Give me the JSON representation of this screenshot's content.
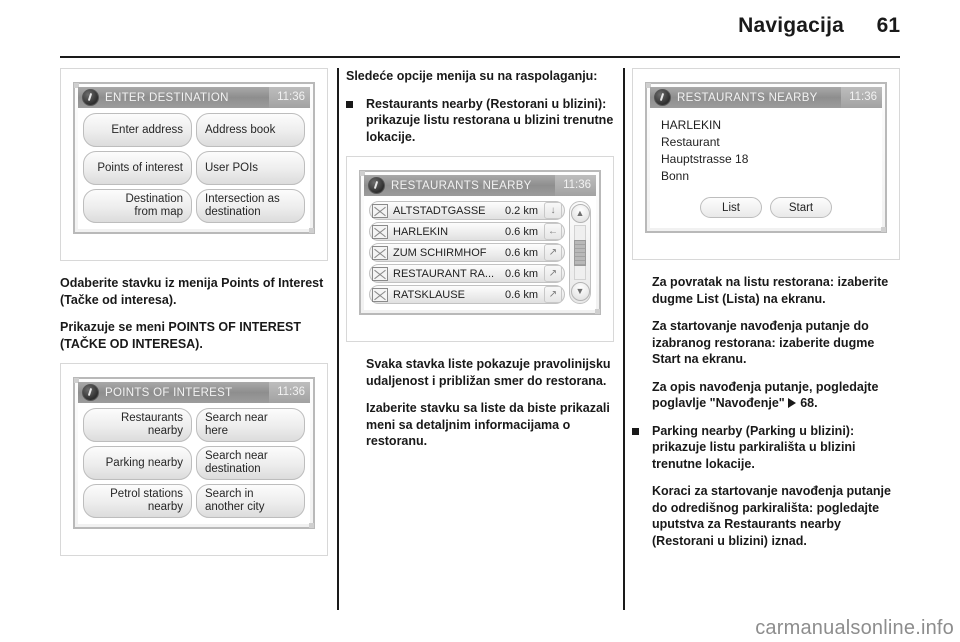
{
  "header": {
    "title": "Navigacija",
    "page_number": "61"
  },
  "watermark": "carmanualsonline.info",
  "columns": {
    "left": {
      "figure1": {
        "title": "ENTER DESTINATION",
        "clock": "11:36",
        "buttons": [
          "Enter address",
          "Address book",
          "Points of interest",
          "User POIs",
          "Destination\nfrom map",
          "Intersection as\ndestination"
        ]
      },
      "para1": "Odaberite stavku iz menija Points of Interest (Tačke od interesa).",
      "para2": "Prikazuje se meni POINTS OF INTEREST (TAČKE OD INTERESA).",
      "figure2": {
        "title": "POINTS OF INTEREST",
        "clock": "11:36",
        "buttons": [
          "Restaurants\nnearby",
          "Search near\nhere",
          "Parking nearby",
          "Search near\ndestination",
          "Petrol stations\nnearby",
          "Search in\nanother city"
        ]
      }
    },
    "middle": {
      "para1": "Sledeće opcije menija su na raspolaganju:",
      "bullet1": "Restaurants nearby (Restorani u blizini): prikazuje listu restorana u blizini trenutne lokacije.",
      "figure1": {
        "title": "RESTAURANTS NEARBY",
        "clock": "11:36",
        "rows": [
          {
            "name": "ALTSTADTGASSE",
            "distance": "0.2 km",
            "arrow": "↓"
          },
          {
            "name": "HARLEKIN",
            "distance": "0.6 km",
            "arrow": "←"
          },
          {
            "name": "ZUM SCHIRMHOF",
            "distance": "0.6 km",
            "arrow": "↗"
          },
          {
            "name": "RESTAURANT RA...",
            "distance": "0.6 km",
            "arrow": "↗"
          },
          {
            "name": "RATSKLAUSE",
            "distance": "0.6 km",
            "arrow": "↗"
          }
        ],
        "scroll_up": "▲",
        "scroll_down": "▼"
      },
      "para2": "Svaka stavka liste pokazuje pravolinijsku udaljenost i približan smer do restorana.",
      "para3": "Izaberite stavku sa liste da biste prikazali meni sa detaljnim informacijama o restoranu."
    },
    "right": {
      "figure1": {
        "title": "RESTAURANTS NEARBY",
        "clock": "11:36",
        "detail_lines": [
          "HARLEKIN",
          "Restaurant",
          "Hauptstrasse 18",
          "Bonn"
        ],
        "buttons": [
          "List",
          "Start"
        ]
      },
      "para1": "Za povratak na listu restorana: izaberite dugme List (Lista) na ekranu.",
      "para2": "Za startovanje navođenja putanje do izabranog restorana: izaberite dugme Start na ekranu.",
      "para3_pre": "Za opis navođenja putanje, pogledajte poglavlje \"Navođenje\"",
      "para3_ref": "68.",
      "bullet1": "Parking nearby (Parking u blizini): prikazuje listu parkirališta u blizini trenutne lokacije.",
      "para4": "Koraci za startovanje navođenja putanje do odredišnog parkirališta: pogledajte uputstva za Restaurants nearby (Restorani u blizini) iznad."
    }
  }
}
